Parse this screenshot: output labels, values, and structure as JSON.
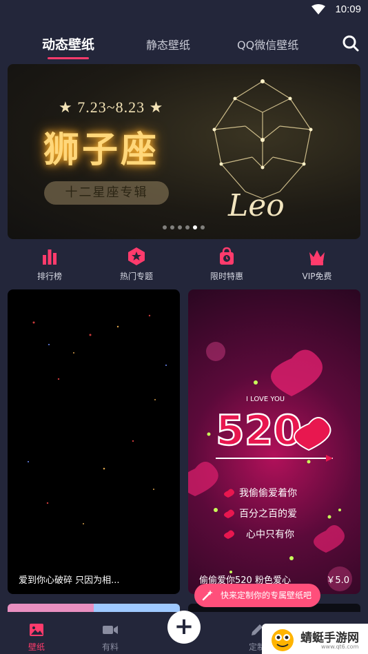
{
  "status_bar": {
    "time": "10:09"
  },
  "tabs": [
    {
      "label": "动态壁纸",
      "active": true
    },
    {
      "label": "静态壁纸",
      "active": false
    },
    {
      "label": "QQ微信壁纸",
      "active": false
    }
  ],
  "banner": {
    "date": "★ 7.23~8.23 ★",
    "title": "狮子座",
    "subtitle": "十二星座专辑",
    "leo": "Leo",
    "dots_total": 6,
    "dots_active": 5
  },
  "quick_nav": [
    {
      "label": "排行榜",
      "icon": "bar-chart-icon",
      "color": "#ff3b6c"
    },
    {
      "label": "热门专题",
      "icon": "star-hexagon-icon",
      "color": "#ff3b6c"
    },
    {
      "label": "限时特惠",
      "icon": "timer-bag-icon",
      "color": "#ff3b6c"
    },
    {
      "label": "VIP免费",
      "icon": "crown-icon",
      "color": "#ff3b6c"
    }
  ],
  "cards": [
    {
      "caption": "爱到你心破碎 只因为相...",
      "price": ""
    },
    {
      "caption": "偷偷爱你520 粉色爱心",
      "price": "￥5.0",
      "art_text": [
        "I LOVE YOU",
        "520",
        "我偷偷爱着你",
        "百分之百的爱",
        "心中只有你"
      ]
    }
  ],
  "tooltip": {
    "label": "快来定制你的专属壁纸吧"
  },
  "bottom_nav": [
    {
      "label": "壁纸",
      "icon": "image-icon",
      "active": true
    },
    {
      "label": "有料",
      "icon": "video-camera-icon",
      "active": false
    },
    {
      "label": "定制",
      "icon": "pencil-icon",
      "active": false
    }
  ],
  "fab": {
    "symbol": "+"
  },
  "watermark": {
    "text": "蜻蜓手游网",
    "sub": "www.qt6.com"
  },
  "colors": {
    "accent": "#ff3b6c",
    "background": "#23263a"
  }
}
